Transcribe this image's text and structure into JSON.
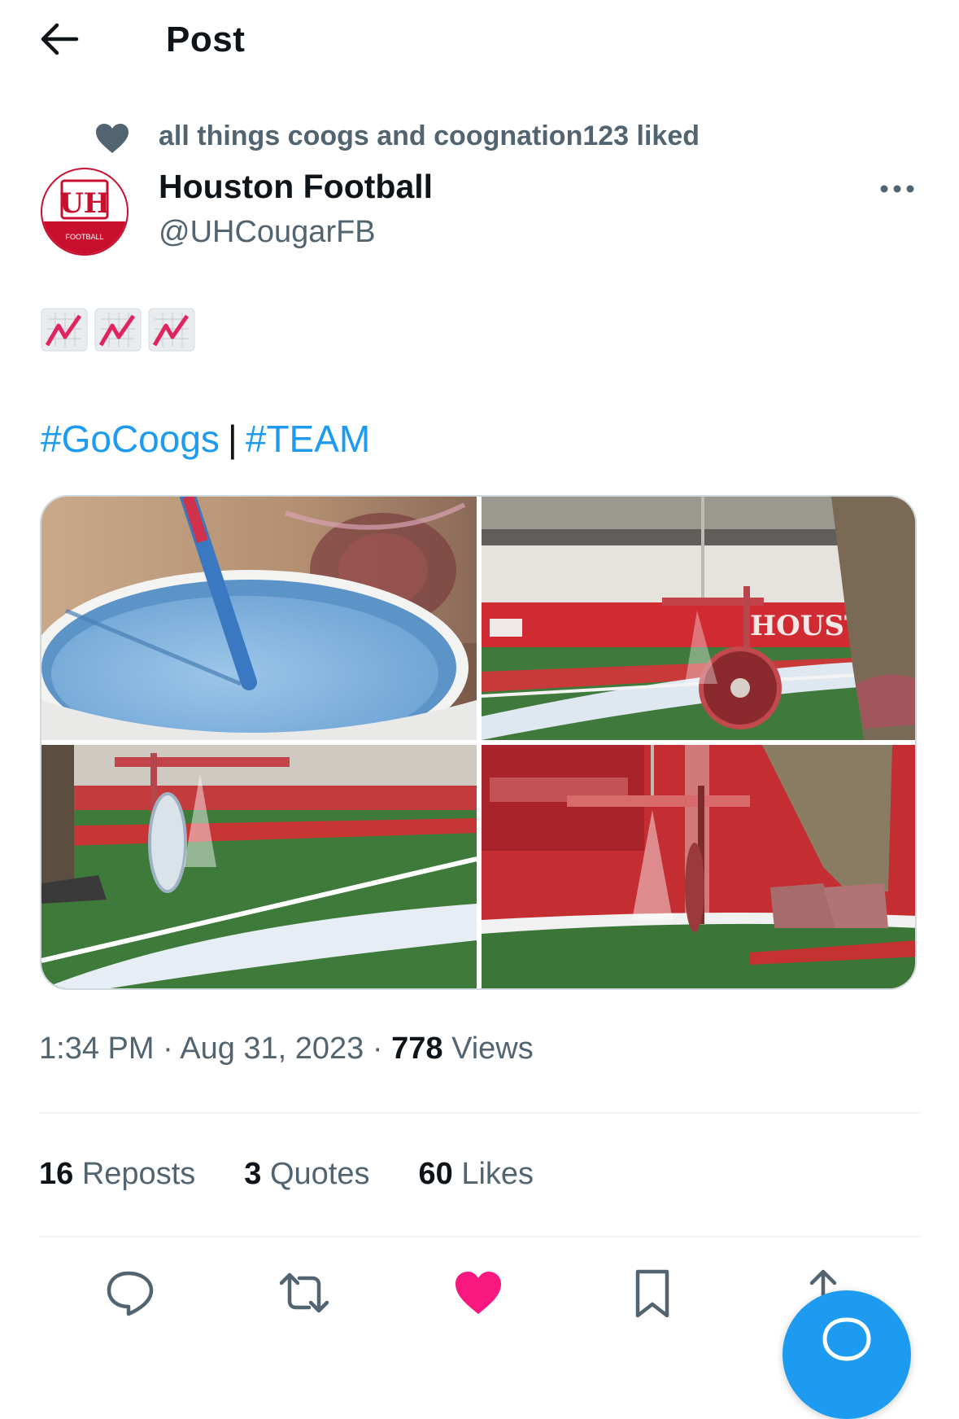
{
  "header": {
    "title": "Post",
    "back_icon": "arrow-left-icon"
  },
  "social_context": {
    "icon": "heart-icon",
    "text": "all things coogs and coognation123 liked"
  },
  "author": {
    "display_name": "Houston Football",
    "handle": "@UHCougarFB",
    "avatar_letters": "UH",
    "avatar_sub": "FOOTBALL",
    "avatar_color": "#c8102e"
  },
  "tweet": {
    "emojis": [
      "chart-increasing-emoji",
      "chart-increasing-emoji",
      "chart-increasing-emoji"
    ],
    "hashtags": [
      "#GoCoogs",
      "#TEAM"
    ],
    "separator": "|",
    "media": [
      {
        "description_icon": "paint-bucket-photo"
      },
      {
        "description_icon": "line-painter-stadium-photo"
      },
      {
        "description_icon": "line-painter-turf-photo"
      },
      {
        "description_icon": "line-painter-spray-photo"
      }
    ]
  },
  "meta": {
    "time": "1:34 PM",
    "dot1": "·",
    "date": "Aug 31, 2023",
    "dot2": "·",
    "views_count": "778",
    "views_label": "Views"
  },
  "stats": {
    "reposts_count": "16",
    "reposts_label": "Reposts",
    "quotes_count": "3",
    "quotes_label": "Quotes",
    "likes_count": "60",
    "likes_label": "Likes"
  },
  "colors": {
    "accent": "#1d9bf0",
    "like": "#f91880",
    "secondary_text": "#536471",
    "primary_text": "#0f1419"
  },
  "actions": [
    "reply-icon",
    "repost-icon",
    "like-icon",
    "bookmark-icon",
    "share-icon"
  ],
  "fab": {
    "icon": "compose-icon"
  }
}
